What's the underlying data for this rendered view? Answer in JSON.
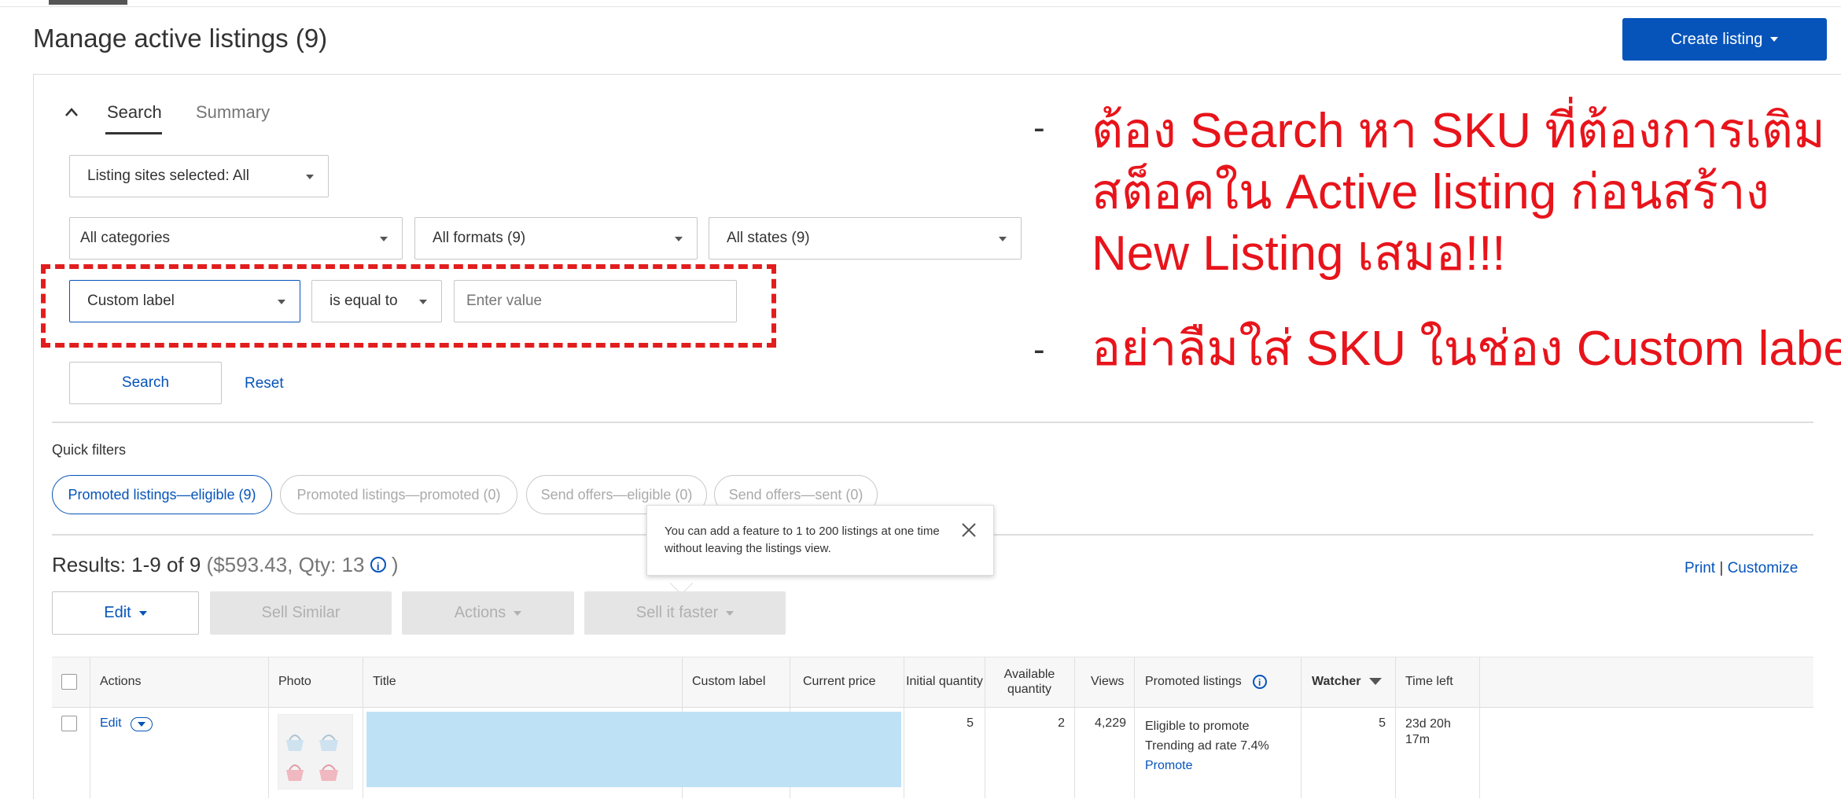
{
  "header": {
    "title": "Manage active listings (9)",
    "create_listing_label": "Create listing"
  },
  "search_panel": {
    "tabs": [
      "Search",
      "Summary"
    ],
    "listing_sites": "Listing sites selected: All",
    "categories": "All categories",
    "formats": "All formats (9)",
    "states": "All states (9)",
    "field_select": "Custom label",
    "operator_select": "is equal to",
    "value_placeholder": "Enter value",
    "search_button": "Search",
    "reset_link": "Reset"
  },
  "quick_filters": {
    "label": "Quick filters",
    "chips": [
      "Promoted listings—eligible (9)",
      "Promoted listings—promoted (0)",
      "Send offers—eligible (0)",
      "Send offers—sent (0)"
    ]
  },
  "tooltip": {
    "text": "You can add a feature to 1 to 200 listings at one time without leaving the listings view."
  },
  "results": {
    "label": "Results: 1-9 of 9",
    "summary_open": "($593.43, Qty: 13",
    "summary_close": ")",
    "print": "Print",
    "separator": "|",
    "customize": "Customize"
  },
  "toolbar": {
    "edit": "Edit",
    "sell_similar": "Sell Similar",
    "actions": "Actions",
    "sell_faster": "Sell it faster"
  },
  "table": {
    "headers": {
      "actions": "Actions",
      "photo": "Photo",
      "title": "Title",
      "custom_label": "Custom label",
      "current_price": "Current price",
      "initial_quantity": "Initial quantity",
      "available_quantity": "Available quantity",
      "views": "Views",
      "promoted_listings": "Promoted listings",
      "watchers": "Watcher",
      "time_left": "Time left"
    },
    "rows": [
      {
        "action": "Edit",
        "initial_quantity": "5",
        "available_quantity": "2",
        "views": "4,229",
        "promoted_status": "Eligible to promote",
        "ad_rate": "Trending ad rate 7.4%",
        "promote_link": "Promote",
        "watchers": "5",
        "time_left": "23d 20h 17m"
      }
    ]
  },
  "annotations": {
    "line1": "ต้อง Search หา SKU ที่ต้องการเติม",
    "line2": "สต็อคใน Active listing ก่อนสร้าง",
    "line3": "New Listing เสมอ!!!",
    "line4": "อย่าลืมใส่ SKU ในช่อง Custom label",
    "bullet": "-"
  },
  "colors": {
    "primary": "#0654ba",
    "annotation_red": "#e8141b",
    "highlight": "#bfe1f6"
  }
}
